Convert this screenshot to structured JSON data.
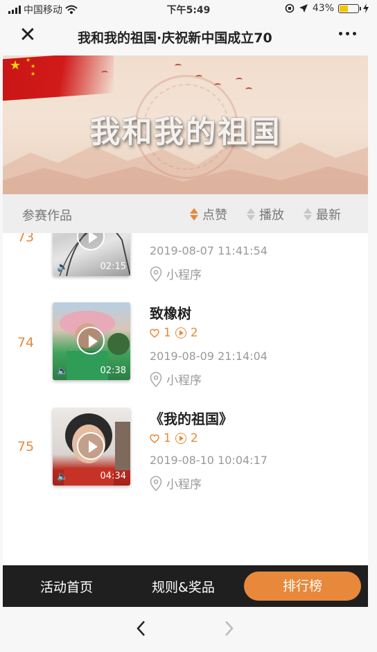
{
  "status_bar": {
    "carrier": "中国移动",
    "time": "下午5:49",
    "battery": "43%",
    "battery_level": 0.43
  },
  "nav": {
    "title": "我和我的祖国·庆祝新中国成立70"
  },
  "banner": {
    "title": "我和我的祖国"
  },
  "sort_bar": {
    "label": "参赛作品",
    "options": [
      {
        "label": "点赞",
        "active": true
      },
      {
        "label": "播放",
        "active": false
      },
      {
        "label": "最新",
        "active": false
      }
    ]
  },
  "entries": [
    {
      "rank": "73",
      "title": "",
      "likes": "",
      "plays": "",
      "duration": "02:15",
      "date": "2019-08-07 11:41:54",
      "location": "小程序"
    },
    {
      "rank": "74",
      "title": "致橡树",
      "likes": "1",
      "plays": "2",
      "duration": "02:38",
      "date": "2019-08-09 21:14:04",
      "location": "小程序"
    },
    {
      "rank": "75",
      "title": "《我的祖国》",
      "likes": "1",
      "plays": "2",
      "duration": "04:34",
      "date": "2019-08-10 10:04:17",
      "location": "小程序"
    }
  ],
  "bottom_tabs": [
    {
      "label": "活动首页"
    },
    {
      "label": "规则&奖品"
    },
    {
      "label": "排行榜",
      "active": true
    }
  ],
  "colors": {
    "accent": "#e8883a",
    "tab_bar": "#1f1f1f"
  }
}
